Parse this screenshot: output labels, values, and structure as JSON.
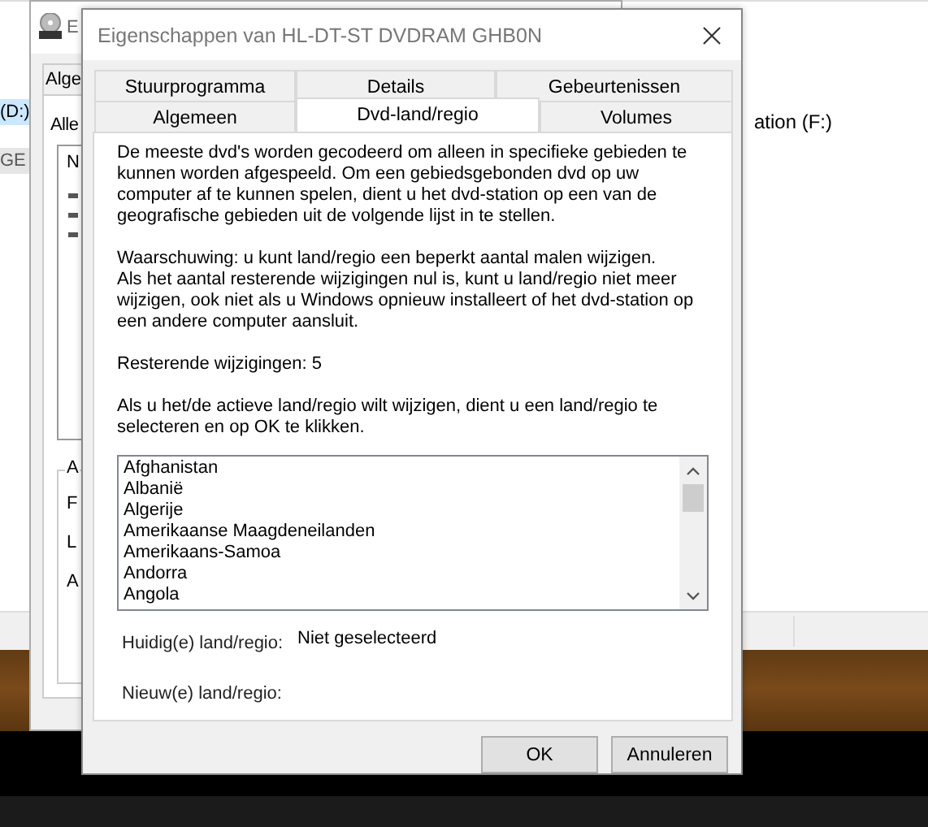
{
  "explorer": {
    "sidebar_items": [
      {
        "label": "(D:)",
        "selected": true
      },
      {
        "label": "GE",
        "selected": false
      }
    ],
    "drive_label": "ation (F:)"
  },
  "background_window": {
    "title": "E",
    "tab": "Alge",
    "group_label": "Alle",
    "list_header": "N",
    "section_label": "A",
    "field_labels": [
      "F",
      "L",
      "A"
    ]
  },
  "dialog": {
    "title": "Eigenschappen van HL-DT-ST DVDRAM GHB0N",
    "tab_rows": [
      [
        {
          "label": "Stuurprogramma",
          "selected": false
        },
        {
          "label": "Details",
          "selected": false
        },
        {
          "label": "Gebeurtenissen",
          "selected": false
        }
      ],
      [
        {
          "label": "Algemeen",
          "selected": false
        },
        {
          "label": "Dvd-land/regio",
          "selected": true
        },
        {
          "label": "Volumes",
          "selected": false
        }
      ]
    ],
    "paragraphs": [
      [
        "De meeste dvd's worden gecodeerd om alleen in specifieke gebieden te kunnen worden afgespeeld. Om een gebiedsgebonden dvd op uw computer af te kunnen spelen, dient u het dvd-station op een van de geografische gebieden uit de volgende lijst in te stellen."
      ],
      [
        "Waarschuwing: u kunt land/regio een beperkt aantal malen wijzigen.",
        "Als het aantal resterende wijzigingen nul is, kunt u land/regio niet meer wijzigen, ook niet als u Windows opnieuw installeert of het dvd-station op een andere computer aansluit."
      ],
      [
        "Resterende wijzigingen: 5"
      ],
      [
        "Als u het/de actieve land/regio wilt wijzigen, dient u een land/regio te selecteren en op OK te klikken."
      ]
    ],
    "regions": [
      "Afghanistan",
      "Albanië",
      "Algerije",
      "Amerikaanse Maagdeneilanden",
      "Amerikaans-Samoa",
      "Andorra",
      "Angola"
    ],
    "current_label": "Huidig(e) land/regio:",
    "current_value": "Niet geselecteerd",
    "new_label": "Nieuw(e) land/regio:",
    "buttons": [
      "OK",
      "Annuleren"
    ]
  }
}
